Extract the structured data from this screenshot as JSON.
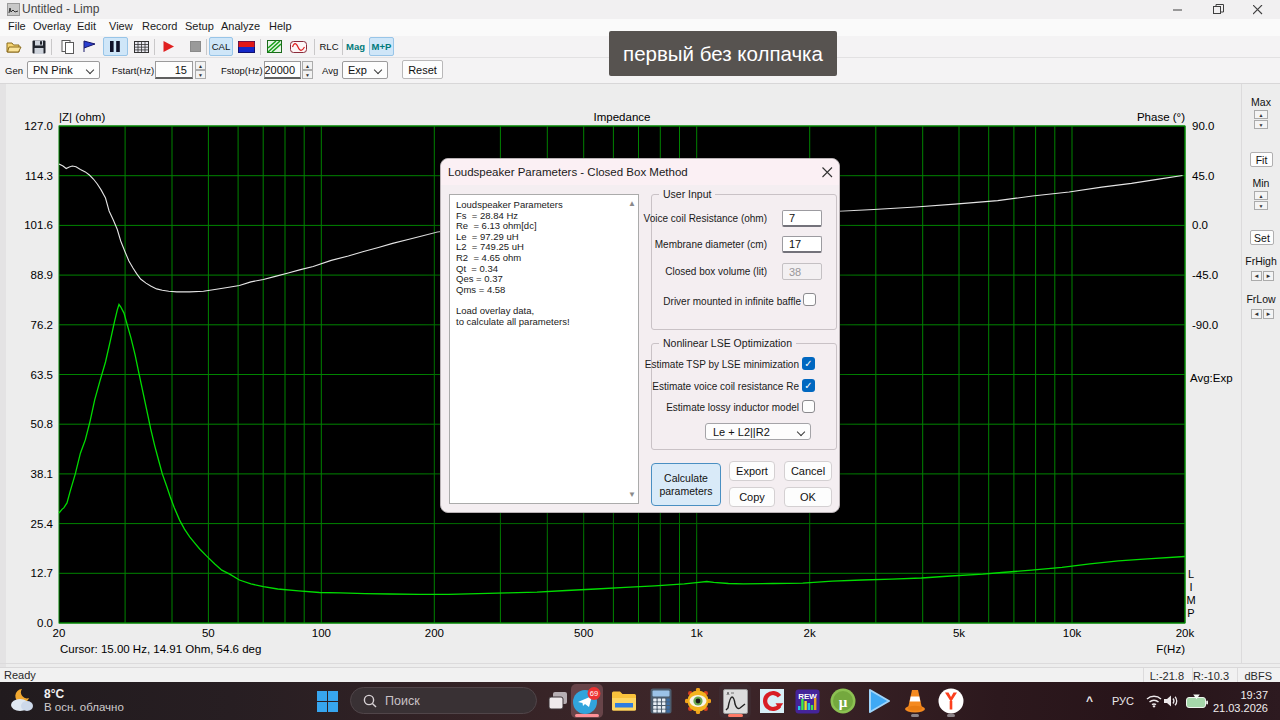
{
  "window": {
    "title": "Untitled - Limp",
    "menu": [
      "File",
      "Overlay",
      "Edit",
      "View",
      "Record",
      "Setup",
      "Analyze",
      "Help"
    ],
    "controls": [
      "minimize",
      "restore",
      "close"
    ]
  },
  "toolbar": {
    "buttons": [
      "open",
      "save",
      "copy",
      "overlay-flag",
      "pause",
      "table",
      "record-play",
      "stop",
      "CAL",
      "flag-redblue",
      "generator",
      "sine",
      "RLC",
      "Mag",
      "M+P"
    ],
    "cal_label": "CAL",
    "rlc_label": "RLC",
    "mag_label": "Mag",
    "mp_label": "M+P"
  },
  "controls": {
    "gen_label": "Gen",
    "gen_value": "PN Pink",
    "fstart_label": "Fstart(Hz)",
    "fstart_value": "15",
    "fstop_label": "Fstop(Hz)",
    "fstop_value": "20000",
    "avg_label": "Avg",
    "avg_value": "Exp",
    "reset_label": "Reset"
  },
  "overlay_caption": "первый без колпачка",
  "chart_data": {
    "type": "line",
    "title": "Impedance",
    "ylabel_left": "|Z| (ohm)",
    "ylabel_right": "Phase (°)",
    "xlabel": "F(Hz)",
    "x_min": 20,
    "x_max": 20000,
    "x_log": true,
    "yleft_min": 0,
    "yleft_max": 127,
    "yleft_ticks": [
      "127.0",
      "114.3",
      "101.6",
      "88.9",
      "76.2",
      "63.5",
      "50.8",
      "38.1",
      "25.4",
      "12.7",
      "0.0"
    ],
    "yright_ticks": [
      "90.0",
      "45.0",
      "0.0",
      "-45.0",
      "-90.0"
    ],
    "yright_values": [
      90,
      45,
      0,
      -45,
      -90
    ],
    "x_tick_labels": [
      [
        "20",
        20
      ],
      [
        "50",
        50
      ],
      [
        "100",
        100
      ],
      [
        "200",
        200
      ],
      [
        "500",
        500
      ],
      [
        "1k",
        1000
      ],
      [
        "2k",
        2000
      ],
      [
        "5k",
        5000
      ],
      [
        "10k",
        10000
      ],
      [
        "20k",
        20000
      ]
    ],
    "x_gridlines": [
      30,
      40,
      50,
      60,
      70,
      80,
      90,
      100,
      200,
      300,
      400,
      500,
      600,
      700,
      800,
      900,
      1000,
      2000,
      3000,
      4000,
      5000,
      6000,
      7000,
      8000,
      9000,
      10000,
      20000
    ],
    "grid": true,
    "legend_position": "none",
    "background": "#000000",
    "grid_color": "#008400",
    "series": [
      {
        "name": "impedance",
        "unit": "ohm",
        "color": "#00dc00",
        "points": [
          [
            20,
            28.1
          ],
          [
            20.4,
            29.1
          ],
          [
            20.6,
            29.4
          ],
          [
            21.0,
            30.7
          ],
          [
            21.4,
            33.5
          ],
          [
            22.1,
            38.1
          ],
          [
            22.8,
            43.4
          ],
          [
            23.5,
            46.8
          ],
          [
            24.2,
            51.6
          ],
          [
            24.9,
            57.0
          ],
          [
            25.7,
            61.8
          ],
          [
            26.6,
            66.7
          ],
          [
            27.4,
            72.1
          ],
          [
            28.1,
            76.9
          ],
          [
            28.6,
            80.0
          ],
          [
            28.9,
            81.4
          ],
          [
            29.2,
            80.8
          ],
          [
            29.8,
            79.2
          ],
          [
            30.3,
            76.7
          ],
          [
            31.1,
            72.8
          ],
          [
            31.9,
            68.5
          ],
          [
            32.7,
            63.6
          ],
          [
            33.5,
            58.8
          ],
          [
            34.3,
            54.2
          ],
          [
            35.1,
            49.6
          ],
          [
            36.0,
            45.2
          ],
          [
            36.9,
            41.4
          ],
          [
            37.7,
            38.1
          ],
          [
            38.7,
            35.0
          ],
          [
            39.6,
            32.2
          ],
          [
            40.6,
            29.4
          ],
          [
            41.9,
            26.3
          ],
          [
            43.2,
            24.0
          ],
          [
            44.6,
            22.0
          ],
          [
            46.0,
            20.4
          ],
          [
            47.4,
            18.9
          ],
          [
            49.5,
            17.1
          ],
          [
            52.0,
            15.1
          ],
          [
            54.3,
            13.5
          ],
          [
            57.0,
            12.5
          ],
          [
            60.5,
            11.0
          ],
          [
            64.9,
            10.0
          ],
          [
            70.1,
            9.3
          ],
          [
            76.5,
            8.7
          ],
          [
            87.0,
            8.2
          ],
          [
            98.9,
            7.8
          ],
          [
            112.4,
            7.7
          ],
          [
            130.7,
            7.5
          ],
          [
            152.1,
            7.4
          ],
          [
            182.2,
            7.3
          ],
          [
            218.3,
            7.3
          ],
          [
            261.5,
            7.5
          ],
          [
            313.3,
            7.7
          ],
          [
            375.4,
            7.9
          ],
          [
            449.7,
            8.3
          ],
          [
            538.8,
            8.7
          ],
          [
            645.5,
            9.1
          ],
          [
            773.4,
            9.5
          ],
          [
            926.6,
            10.0
          ],
          [
            1014,
            10.4
          ],
          [
            1064,
            10.6
          ],
          [
            1110,
            10.4
          ],
          [
            1215,
            10.1
          ],
          [
            1331,
            10.0
          ],
          [
            1597,
            10.1
          ],
          [
            1916,
            10.2
          ],
          [
            2299,
            10.7
          ],
          [
            2759,
            11.0
          ],
          [
            3310,
            11.2
          ],
          [
            3971,
            11.5
          ],
          [
            4750,
            12.0
          ],
          [
            5780,
            12.5
          ],
          [
            6501,
            12.9
          ],
          [
            7800,
            13.5
          ],
          [
            9402,
            14.2
          ],
          [
            11160,
            15.1
          ],
          [
            13300,
            15.9
          ],
          [
            15900,
            16.4
          ],
          [
            19970,
            17.0
          ]
        ]
      },
      {
        "name": "phase",
        "unit": "deg",
        "color": "#e4e4e4",
        "points": [
          [
            20,
            55.6
          ],
          [
            20.5,
            53.8
          ],
          [
            20.9,
            51.5
          ],
          [
            21.3,
            52.9
          ],
          [
            21.7,
            53.8
          ],
          [
            22.2,
            53.1
          ],
          [
            22.8,
            50.6
          ],
          [
            23.5,
            48.4
          ],
          [
            24.1,
            45.6
          ],
          [
            24.7,
            42.0
          ],
          [
            25.3,
            37.5
          ],
          [
            25.9,
            32.1
          ],
          [
            26.6,
            24.8
          ],
          [
            27.2,
            13.0
          ],
          [
            27.9,
            4.9
          ],
          [
            28.6,
            -3.7
          ],
          [
            29.2,
            -14.1
          ],
          [
            30.0,
            -24.1
          ],
          [
            30.7,
            -32.2
          ],
          [
            31.5,
            -38.6
          ],
          [
            32.2,
            -43.6
          ],
          [
            33.0,
            -48.5
          ],
          [
            34.1,
            -52.2
          ],
          [
            35.1,
            -54.9
          ],
          [
            36.4,
            -57.5
          ],
          [
            37.7,
            -58.8
          ],
          [
            39.2,
            -59.7
          ],
          [
            41.2,
            -60.2
          ],
          [
            44.6,
            -60.2
          ],
          [
            48.5,
            -59.6
          ],
          [
            52.0,
            -58.0
          ],
          [
            56.2,
            -56.2
          ],
          [
            60.5,
            -54.4
          ],
          [
            64.9,
            -51.2
          ],
          [
            70.1,
            -49.0
          ],
          [
            75.4,
            -46.2
          ],
          [
            81.6,
            -43.1
          ],
          [
            88.0,
            -40.0
          ],
          [
            95.1,
            -37.2
          ],
          [
            106.2,
            -31.7
          ],
          [
            118.0,
            -27.7
          ],
          [
            128.9,
            -23.8
          ],
          [
            141.9,
            -20.0
          ],
          [
            154.8,
            -16.3
          ],
          [
            170.3,
            -12.8
          ],
          [
            186.5,
            -9.3
          ],
          [
            203.9,
            -6.0
          ],
          [
            228,
            -3.7
          ],
          [
            261,
            -1.4
          ],
          [
            296,
            0.4
          ],
          [
            356,
            2.6
          ],
          [
            428,
            4.9
          ],
          [
            546,
            7.6
          ],
          [
            696,
            9.6
          ],
          [
            888,
            11.0
          ],
          [
            1133,
            11.9
          ],
          [
            1445,
            12.3
          ],
          [
            1843,
            12.6
          ],
          [
            2394,
            12.9
          ],
          [
            2962,
            14.4
          ],
          [
            3836,
            16.7
          ],
          [
            4965,
            19.5
          ],
          [
            6337,
            22.5
          ],
          [
            7849,
            26.6
          ],
          [
            9822,
            30.2
          ],
          [
            12000,
            34.7
          ],
          [
            14400,
            38.0
          ],
          [
            17200,
            42.1
          ],
          [
            19700,
            45.2
          ]
        ]
      }
    ]
  },
  "right_panel": {
    "max_label": "Max",
    "fit_label": "Fit",
    "min_label": "Min",
    "set_label": "Set",
    "frhigh_label": "FrHigh",
    "frlow_label": "FrLow",
    "avg_text": "Avg:Exp",
    "limp_letters": [
      "L",
      "I",
      "M",
      "P"
    ]
  },
  "cursor_text": "Cursor: 15.00 Hz, 14.91 Ohm, 54.6 deg",
  "status": {
    "ready": "Ready",
    "left_level": "L:-21.8",
    "right_level": "R:-10.3",
    "unit": "dBFS"
  },
  "dialog": {
    "title": "Loudspeaker Parameters - Closed Box Method",
    "listbox_lines": [
      "Loudspeaker Parameters",
      "Fs  = 28.84 Hz",
      "Re  = 6.13 ohm[dc]",
      "Le  = 97.29 uH",
      "L2  = 749.25 uH",
      "R2  = 4.65 ohm",
      "Qt  = 0.34",
      "Qes = 0.37",
      "Qms = 4.58",
      "",
      "Load overlay data,",
      "to calculate all parameters!"
    ],
    "user_input": {
      "label": "User Input",
      "rows": [
        {
          "label": "Voice coil Resistance (ohm)",
          "value": "7",
          "disabled": false
        },
        {
          "label": "Membrane diameter (cm)",
          "value": "17",
          "disabled": false
        },
        {
          "label": "Closed box volume (lit)",
          "value": "38",
          "disabled": true
        }
      ],
      "baffle_label": "Driver mounted in infinite baffle",
      "baffle_checked": false
    },
    "lse": {
      "label": "Nonlinear LSE Optimization",
      "checks": [
        {
          "label": "Estimate TSP by LSE minimization",
          "checked": true
        },
        {
          "label": "Estimate voice coil resistance Re",
          "checked": true
        },
        {
          "label": "Estimate lossy inductor model",
          "checked": false
        }
      ],
      "combo_value": "Le + L2||R2"
    },
    "buttons": {
      "calculate": "Calculate parameters",
      "export": "Export",
      "cancel": "Cancel",
      "copy": "Copy",
      "ok": "OK"
    }
  },
  "taskbar": {
    "weather": {
      "temp": "8°C",
      "desc": "В осн. облачно"
    },
    "search_placeholder": "Поиск",
    "apps": [
      {
        "name": "telegram",
        "badge": "69",
        "active": true,
        "pill": "wide"
      },
      {
        "name": "explorer"
      },
      {
        "name": "calculator"
      },
      {
        "name": "eye-app"
      },
      {
        "name": "limp-app",
        "active": true,
        "pill": "narrow"
      },
      {
        "name": "red-c-app"
      },
      {
        "name": "rew",
        "label": "REW"
      },
      {
        "name": "utorrent"
      },
      {
        "name": "media-player"
      },
      {
        "name": "vlc",
        "pill": "dot"
      },
      {
        "name": "yandex-browser",
        "pill": "dot"
      }
    ],
    "tray": {
      "chevron": "^",
      "lang": "РУС",
      "time": "19:37",
      "date": "21.03.2026"
    }
  }
}
